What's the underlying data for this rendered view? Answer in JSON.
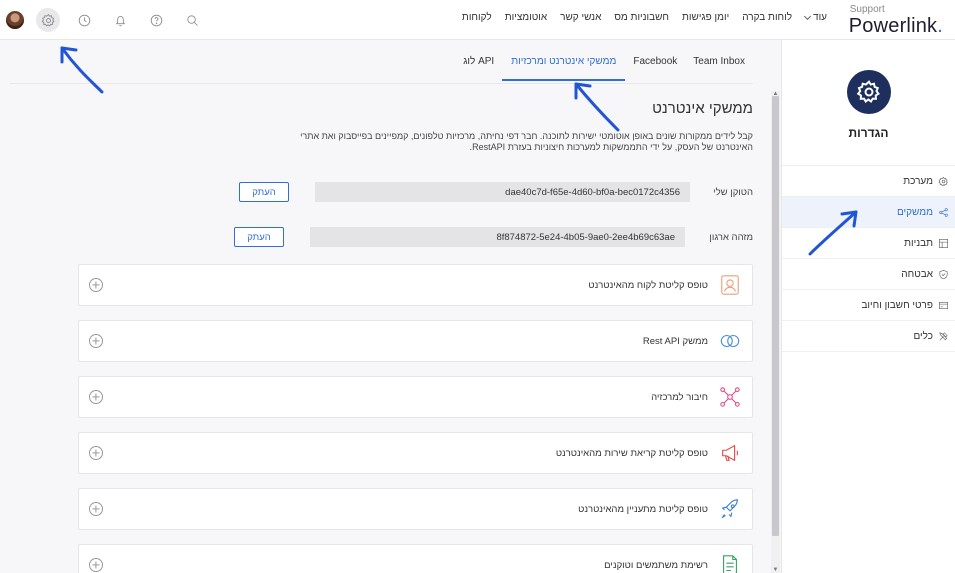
{
  "brand": {
    "support": "Support",
    "name": "Powerlink",
    "dot": ".",
    "accent": "#2f6fd6",
    "nav_bg": "#1e2f5e"
  },
  "nav": {
    "items": [
      "לקוחות",
      "אוטומציות",
      "אנשי קשר",
      "חשבוניות מס",
      "יומן פגישות",
      "לוחות בקרה"
    ],
    "more": "עוד"
  },
  "top_icons": [
    "avatar",
    "settings-icon",
    "history-icon",
    "bell-icon",
    "help-icon",
    "search-icon"
  ],
  "sidebar": {
    "title": "הגדרות",
    "items": [
      {
        "label": "מערכת",
        "icon": "gear-icon",
        "active": false
      },
      {
        "label": "ממשקים",
        "icon": "share-icon",
        "active": true
      },
      {
        "label": "תבניות",
        "icon": "layout-icon",
        "active": false
      },
      {
        "label": "אבטחה",
        "icon": "shield-icon",
        "active": false
      },
      {
        "label": "פרטי חשבון וחיוב",
        "icon": "card-icon",
        "active": false
      },
      {
        "label": "כלים",
        "icon": "tools-icon",
        "active": false
      }
    ]
  },
  "tabs": [
    {
      "label": "Team Inbox",
      "active": false
    },
    {
      "label": "Facebook",
      "active": false
    },
    {
      "label": "ממשקי אינטרנט ומרכזיות",
      "active": true
    },
    {
      "label": "לוג API",
      "active": false
    }
  ],
  "section": {
    "title": "ממשקי אינטרנט",
    "description": "קבל לידים ממקורות שונים באופן אוטומטי ישירות לתוכנה. חבר דפי נחיתה, מרכזיות טלפונים, קמפיינים בפייסבוק ואת אתרי האינטרנט של העסק, על ידי התממשקות למערכות חיצוניות בעזרת RestAPI."
  },
  "fields": [
    {
      "label": "הטוקן שלי",
      "value": "dae40c7d-f65e-4d60-bf0a-bec0172c4356",
      "button": "העתק"
    },
    {
      "label": "מזהה ארגון",
      "value": "8f874872-5e24-4b05-9ae0-2ee4b69c63ae",
      "button": "העתק"
    }
  ],
  "cards": [
    {
      "label": "טופס קליטת לקוח מהאינטרנט",
      "icon": "customer-form-icon",
      "color": "#e9a07a"
    },
    {
      "label": "ממשק Rest API",
      "icon": "api-link-icon",
      "color": "#4a90d9"
    },
    {
      "label": "חיבור למרכזיה",
      "icon": "network-hub-icon",
      "color": "#e0508a"
    },
    {
      "label": "טופס קליטת קריאת שירות מהאינטרנט",
      "icon": "megaphone-icon",
      "color": "#e04a4a"
    },
    {
      "label": "טופס קליטת מתעניין מהאינטרנט",
      "icon": "rocket-icon",
      "color": "#3a7bd5"
    },
    {
      "label": "רשימת משתמשים וטוקנים",
      "icon": "list-doc-icon",
      "color": "#3aa06a"
    }
  ]
}
